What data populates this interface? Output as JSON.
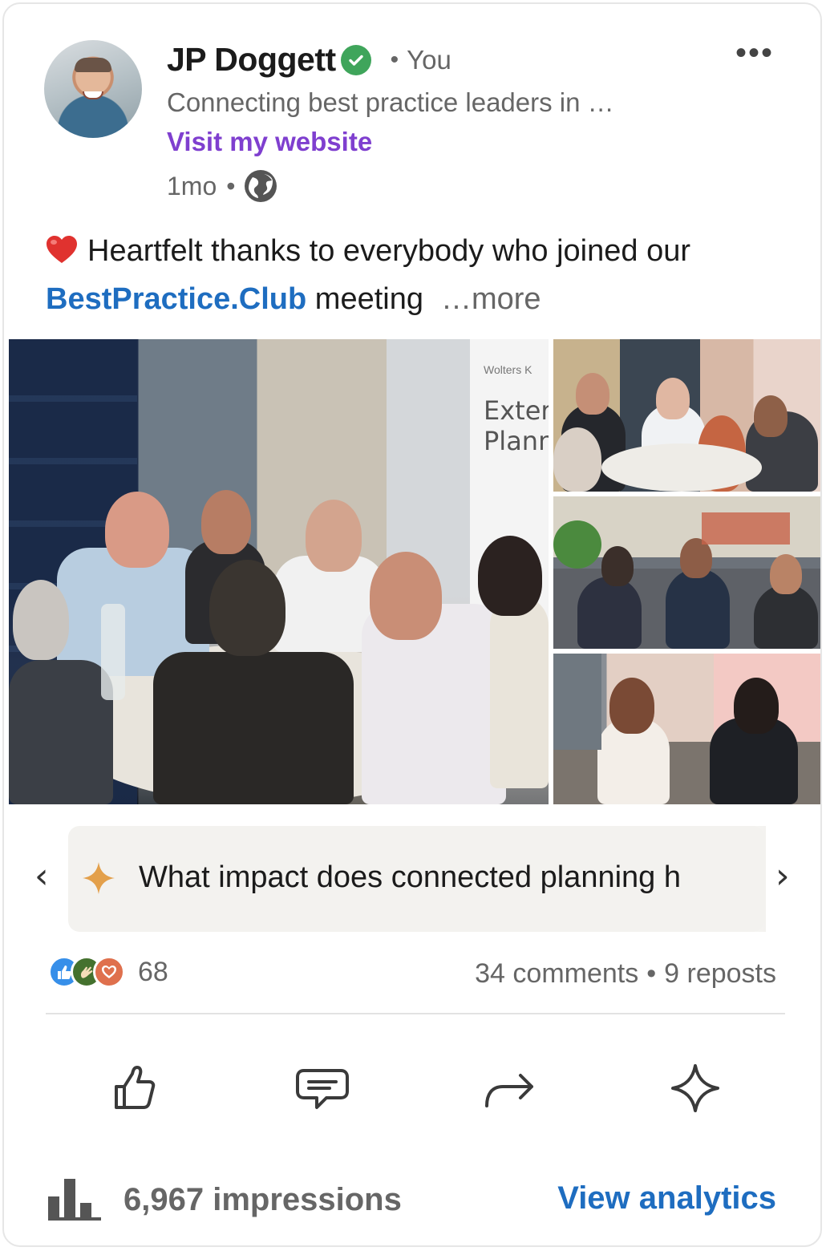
{
  "author": {
    "name": "JP Doggett",
    "relation": "You",
    "headline": "Connecting best practice leaders in …",
    "website_link": "Visit my website",
    "time_ago": "1mo"
  },
  "post": {
    "text_before": "Heartfelt thanks to everybody who joined our ",
    "mention": "BestPractice.Club",
    "text_after": " meeting",
    "more_label": "…more"
  },
  "photos": {
    "banner_brand": "Wolters K",
    "banner_text": "Exter Plann"
  },
  "prompt": {
    "text": "What impact does connected planning h"
  },
  "engagement": {
    "reaction_count": "68",
    "comments": "34 comments",
    "reposts": "9 reposts"
  },
  "actions": [
    "like",
    "comment",
    "repost",
    "ai-assist"
  ],
  "footer": {
    "impressions": "6,967 impressions",
    "analytics_link": "View analytics"
  },
  "colors": {
    "link_blue": "#1e6dc0",
    "website_purple": "#7f3fcf",
    "verified_green": "#3fa55b",
    "sparkle_gold": "#e3a04b"
  },
  "icons": {
    "verified": "verified-check-icon",
    "menu": "more-options-icon",
    "visibility": "globe-icon",
    "reaction_emoji": "red-heart-icon"
  }
}
